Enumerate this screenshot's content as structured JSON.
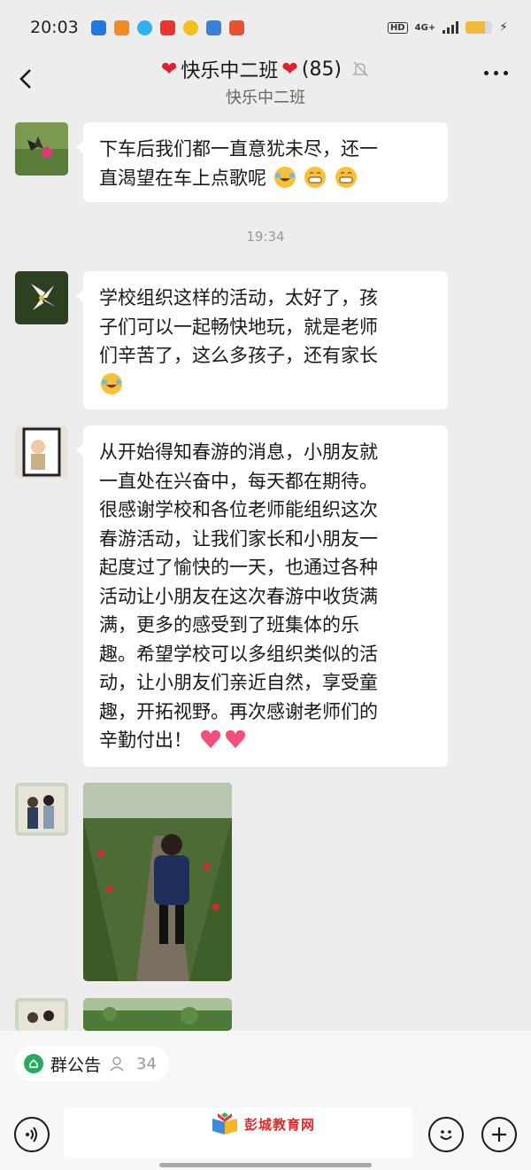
{
  "status_bar": {
    "time": "20:03",
    "hd": "HD",
    "network": "4G+",
    "battery_level": 0.72
  },
  "header": {
    "title_name": "快乐中二班",
    "member_count": "(85)",
    "subtitle": "快乐中二班"
  },
  "messages": [
    {
      "type": "text",
      "text_lines": [
        "下车后我们都一直意犹未尽，还一",
        "直渴望在车上点歌呢"
      ]
    },
    {
      "type": "timestamp",
      "text": "19:34"
    },
    {
      "type": "text",
      "text_lines": [
        "学校组织这样的活动，太好了，孩",
        "子们可以一起畅快地玩，就是老师",
        "们辛苦了，这么多孩子，还有家长"
      ]
    },
    {
      "type": "text",
      "text_lines": [
        "从开始得知春游的消息，小朋友就",
        "一直处在兴奋中，每天都在期待。",
        "很感谢学校和各位老师能组织这次",
        "春游活动，让我们家长和小朋友一",
        "起度过了愉快的一天，也通过各种",
        "活动让小朋友在这次春游中收货满",
        "满，更多的感受到了班集体的乐",
        "趣。希望学校可以多组织类似的活",
        "动，让小朋友们亲近自然，享受童",
        "趣，开拓视野。再次感谢老师们的",
        "辛勤付出！"
      ]
    }
  ],
  "bottom": {
    "group_notice_label": "群公告",
    "notice_count": "34",
    "watermark_text": "彭城教育网"
  },
  "colors": {
    "background": "#ededed",
    "bubble": "#ffffff",
    "heart": "#e0202c",
    "notice_green": "#2aa860"
  }
}
